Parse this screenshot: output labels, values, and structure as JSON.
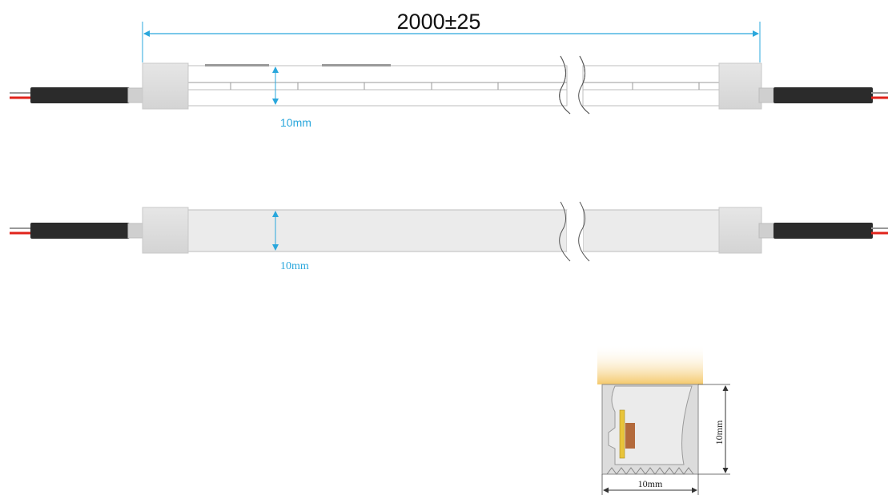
{
  "drawing": {
    "overall_length": "2000±25",
    "strip_top_width": "10mm",
    "strip_side_width": "10mm",
    "section_height": "10mm",
    "section_width": "10mm"
  },
  "colors": {
    "dimension": "#2aa7dc",
    "cable": "#2b2b2b",
    "red_wire": "#e0231b",
    "end_cap": "#dedede",
    "strip_body": "#ebebeb",
    "glow": "#f4c86a",
    "led_chip": "#e8c43a",
    "led_pad": "#b36a3c"
  }
}
